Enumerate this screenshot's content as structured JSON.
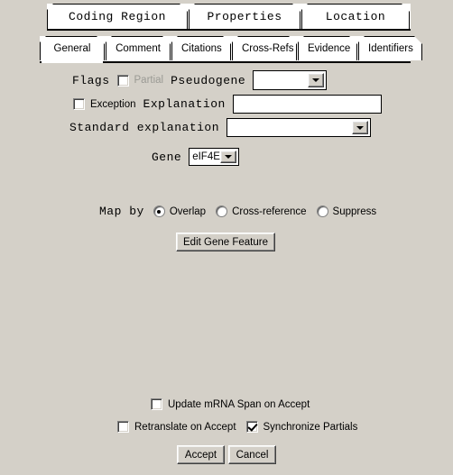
{
  "window": {
    "background_color": "#d4d0c8"
  },
  "outer_tabs": {
    "items": [
      {
        "label": "Coding Region",
        "active": true
      },
      {
        "label": "Properties",
        "active": false
      },
      {
        "label": "Location",
        "active": false
      }
    ]
  },
  "inner_tabs": {
    "items": [
      {
        "label": "General",
        "active": true
      },
      {
        "label": "Comment",
        "active": false
      },
      {
        "label": "Citations",
        "active": false
      },
      {
        "label": "Cross-Refs",
        "active": false
      },
      {
        "label": "Evidence",
        "active": false
      },
      {
        "label": "Identifiers",
        "active": false
      }
    ]
  },
  "form": {
    "flags_label": "Flags",
    "partial_label": "Partial",
    "partial_checked": false,
    "partial_disabled": true,
    "pseudogene_label": "Pseudogene",
    "pseudogene_value": "",
    "exception_label": "Exception",
    "exception_checked": false,
    "explanation_label": "Explanation",
    "explanation_value": "",
    "standard_explanation_label": "Standard explanation",
    "standard_explanation_value": "",
    "gene_label": "Gene",
    "gene_value": "eIF4E",
    "map_by_label": "Map by",
    "map_by_options": [
      {
        "label": "Overlap",
        "selected": true
      },
      {
        "label": "Cross-reference",
        "selected": false
      },
      {
        "label": "Suppress",
        "selected": false
      }
    ],
    "edit_gene_feature_label": "Edit Gene Feature"
  },
  "footer": {
    "update_mrna_span_label": "Update mRNA Span on Accept",
    "update_mrna_span_checked": false,
    "retranslate_label": "Retranslate on Accept",
    "retranslate_checked": false,
    "synchronize_partials_label": "Synchronize Partials",
    "synchronize_partials_checked": true,
    "accept_label": "Accept",
    "cancel_label": "Cancel"
  }
}
